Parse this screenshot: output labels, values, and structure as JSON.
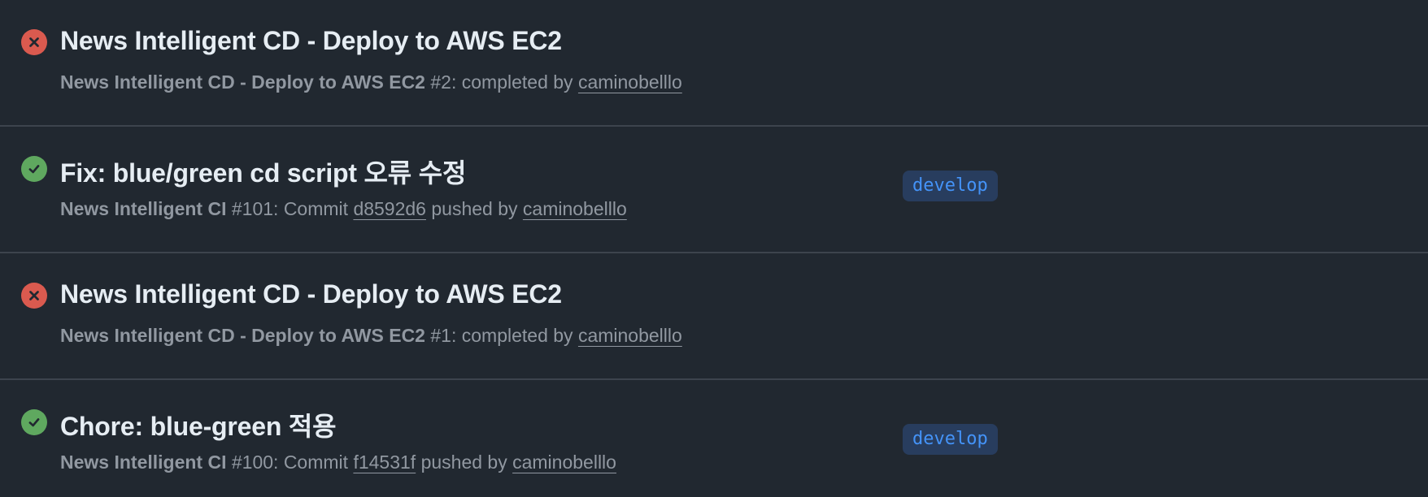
{
  "runs": [
    {
      "status": "failure",
      "status_icon": "x-circle-icon",
      "title": "News Intelligent CD - Deploy to AWS EC2",
      "workflow": "News Intelligent CD - Deploy to AWS EC2",
      "run_number": " #2",
      "event_text": ": completed by ",
      "actor": "caminobelllo"
    },
    {
      "status": "success",
      "status_icon": "check-circle-icon",
      "title": "Fix: blue/green cd script 오류 수정",
      "workflow": "News Intelligent CI",
      "run_number": " #101",
      "event_text": ": Commit ",
      "commit": "d8592d6",
      "pushed_text": " pushed by ",
      "actor": "caminobelllo",
      "branch": "develop"
    },
    {
      "status": "failure",
      "status_icon": "x-circle-icon",
      "title": "News Intelligent CD - Deploy to AWS EC2",
      "workflow": "News Intelligent CD - Deploy to AWS EC2",
      "run_number": " #1",
      "event_text": ": completed by ",
      "actor": "caminobelllo"
    },
    {
      "status": "success",
      "status_icon": "check-circle-icon",
      "title": "Chore: blue-green 적용",
      "workflow": "News Intelligent CI",
      "run_number": " #100",
      "event_text": ": Commit ",
      "commit": "f14531f",
      "pushed_text": " pushed by ",
      "actor": "caminobelllo",
      "branch": "develop"
    }
  ],
  "colors": {
    "background": "#212830",
    "failure": "#da5a4f",
    "success": "#5fa85f",
    "branch_text": "#4493f8",
    "branch_bg": "#283d5e"
  }
}
